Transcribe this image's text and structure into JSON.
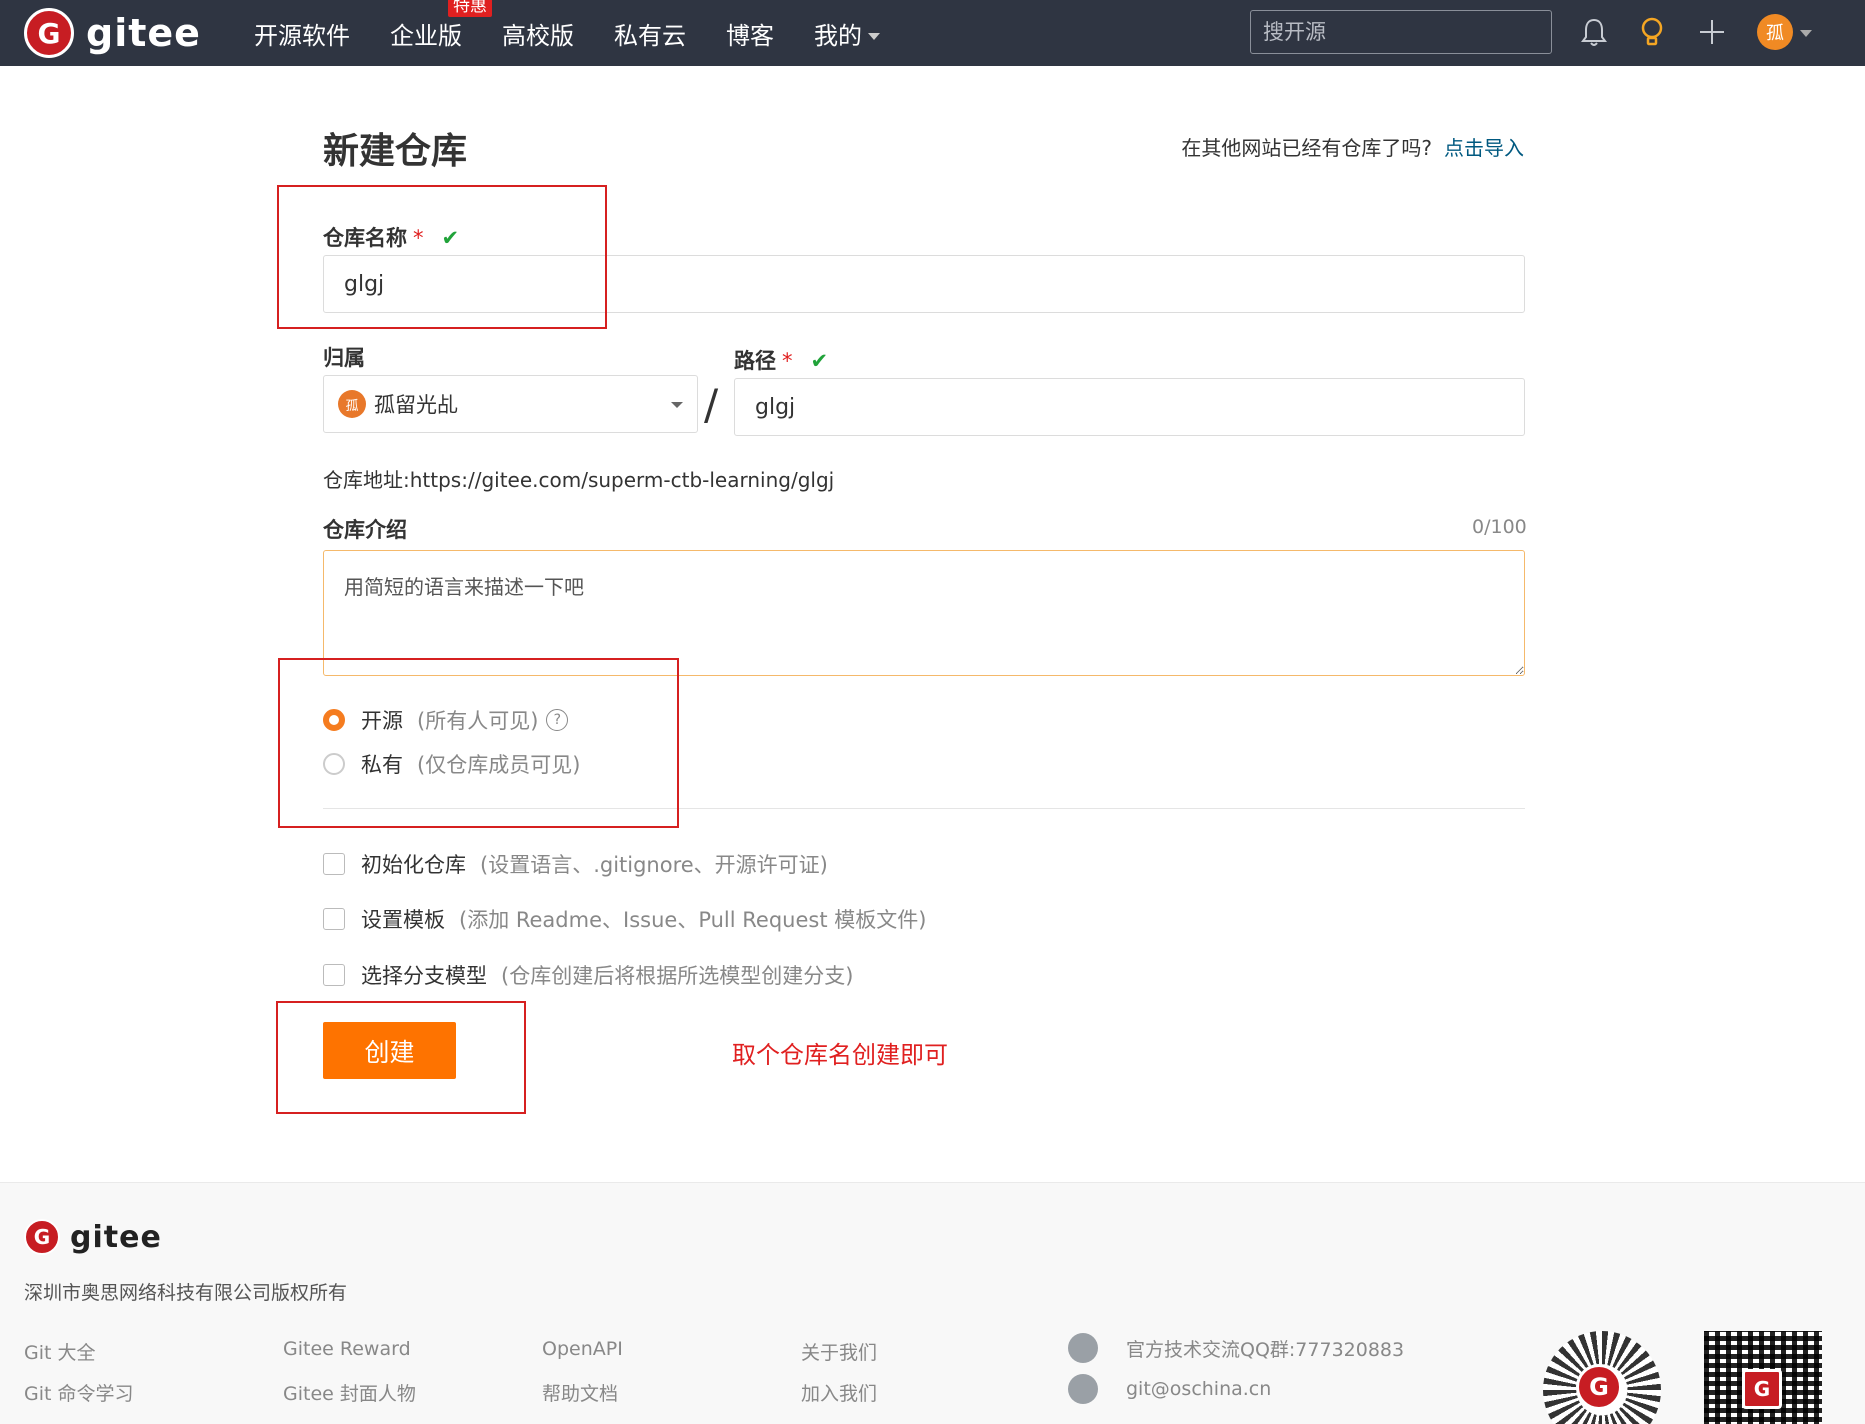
{
  "nav": {
    "logo_text": "gitee",
    "logo_letter": "G",
    "items": [
      {
        "label": "开源软件"
      },
      {
        "label": "企业版",
        "badge": "特惠"
      },
      {
        "label": "高校版"
      },
      {
        "label": "私有云"
      },
      {
        "label": "博客"
      },
      {
        "label": "我的"
      }
    ],
    "search_placeholder": "搜开源",
    "avatar_text": "孤"
  },
  "form": {
    "title": "新建仓库",
    "import_hint": "在其他网站已经有仓库了吗?",
    "import_link": "点击导入",
    "repo_name_label": "仓库名称",
    "required_mark": "*",
    "check_mark": "✔",
    "repo_name_value": "glgj",
    "owner_label": "归属",
    "owner_value": "孤留光乩",
    "owner_avatar": "孤",
    "path_label": "路径",
    "path_value": "glgj",
    "slash": "/",
    "repo_url_label": "仓库地址:",
    "repo_url": "https://gitee.com/superm-ctb-learning/glgj",
    "intro_label": "仓库介绍",
    "intro_counter": "0/100",
    "intro_placeholder": "用简短的语言来描述一下吧",
    "visibility": [
      {
        "label": "开源",
        "hint": "(所有人可见)",
        "checked": true
      },
      {
        "label": "私有",
        "hint": "(仅仓库成员可见)",
        "checked": false
      }
    ],
    "help_glyph": "?",
    "options": [
      {
        "label": "初始化仓库",
        "hint": "(设置语言、.gitignore、开源许可证)"
      },
      {
        "label": "设置模板",
        "hint": "(添加 Readme、Issue、Pull Request 模板文件)"
      },
      {
        "label": "选择分支模型",
        "hint": "(仓库创建后将根据所选模型创建分支)"
      }
    ],
    "create_button": "创建",
    "annotation": "取个仓库名创建即可"
  },
  "footer": {
    "logo_text": "gitee",
    "copyright": "深圳市奥思网络科技有限公司版权所有",
    "links": [
      [
        "Git 大全",
        "Git 命令学习"
      ],
      [
        "Gitee Reward",
        "Gitee 封面人物"
      ],
      [
        "OpenAPI",
        "帮助文档"
      ],
      [
        "关于我们",
        "加入我们"
      ]
    ],
    "qq_group": "官方技术交流QQ群:777320883",
    "email": "git@oschina.cn"
  },
  "colors": {
    "nav_bg": "#2f3542",
    "accent_orange": "#fe7300",
    "brand_red": "#c71d23",
    "annotation_red": "#e02020",
    "link_blue": "#005980",
    "check_green": "#21a33a"
  }
}
